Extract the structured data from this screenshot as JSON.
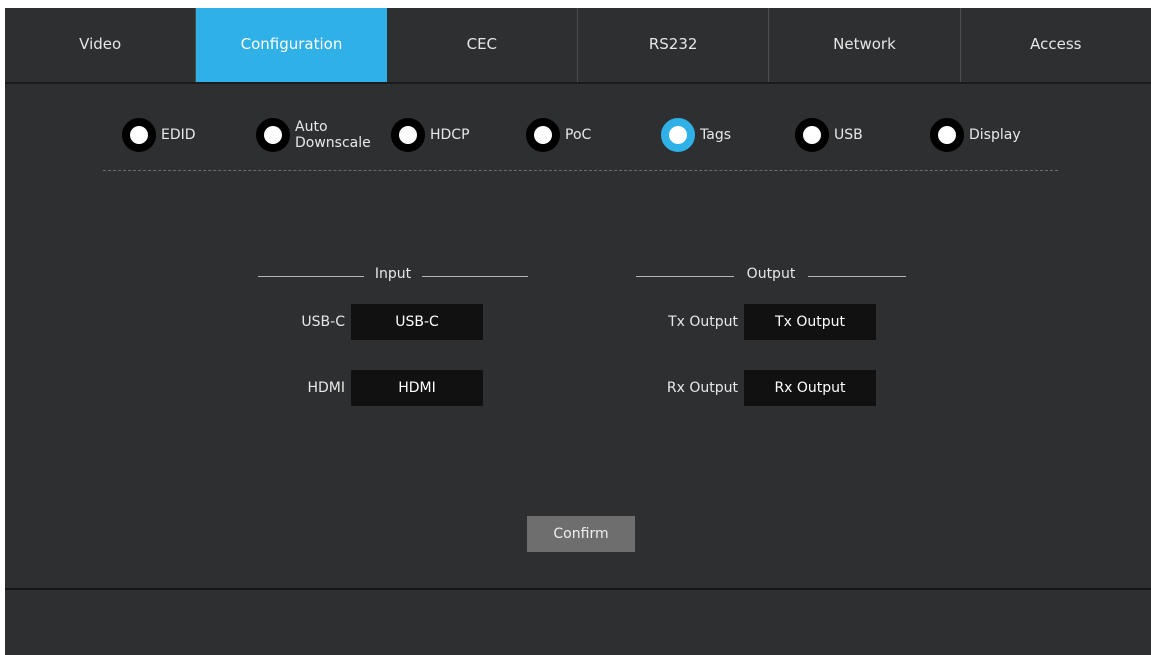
{
  "tabs": [
    {
      "label": "Video",
      "active": false
    },
    {
      "label": "Configuration",
      "active": true
    },
    {
      "label": "CEC",
      "active": false
    },
    {
      "label": "RS232",
      "active": false
    },
    {
      "label": "Network",
      "active": false
    },
    {
      "label": "Access",
      "active": false
    }
  ],
  "options": [
    {
      "label": "EDID",
      "selected": false
    },
    {
      "label": "Auto",
      "label2": "Downscale",
      "selected": false
    },
    {
      "label": "HDCP",
      "selected": false
    },
    {
      "label": "PoC",
      "selected": false
    },
    {
      "label": "Tags",
      "selected": true
    },
    {
      "label": "USB",
      "selected": false
    },
    {
      "label": "Display",
      "selected": false
    }
  ],
  "input": {
    "title": "Input",
    "rows": [
      {
        "label": "USB-C",
        "value": "USB-C"
      },
      {
        "label": "HDMI",
        "value": "HDMI"
      }
    ]
  },
  "output": {
    "title": "Output",
    "rows": [
      {
        "label": "Tx Output",
        "value": "Tx Output"
      },
      {
        "label": "Rx Output",
        "value": "Rx Output"
      }
    ]
  },
  "confirm_label": "Confirm",
  "colors": {
    "accent": "#2fb0e6",
    "background": "#2d2f31",
    "field": "#111111",
    "button": "#6e6e6e"
  }
}
